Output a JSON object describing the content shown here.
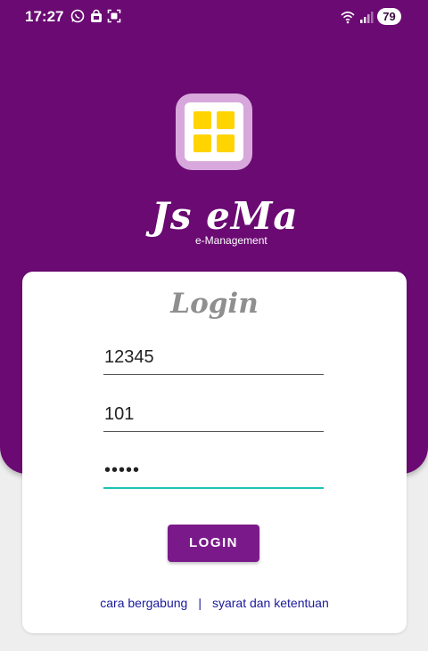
{
  "status_bar": {
    "time": "17:27",
    "battery": "79",
    "left_icons": [
      "whatsapp-icon",
      "shop-icon",
      "screen-scan-icon"
    ],
    "right_icons": [
      "wifi-icon",
      "signal-icon"
    ]
  },
  "brand": {
    "logo_icon": "grid-icon",
    "name": "Js eMa",
    "subtitle": "e-Management"
  },
  "login": {
    "title": "Login",
    "username_value": "12345",
    "code_value": "101",
    "password_value": "•••••",
    "button_label": "LOGIN"
  },
  "links": {
    "join": "cara bergabung",
    "separator": "|",
    "terms": "syarat dan ketentuan"
  },
  "colors": {
    "header": "#6a0a72",
    "button": "#7a1a8a",
    "tile": "#ffd400",
    "focus_underline": "#1ec3b5",
    "link": "#1a1a9c"
  }
}
